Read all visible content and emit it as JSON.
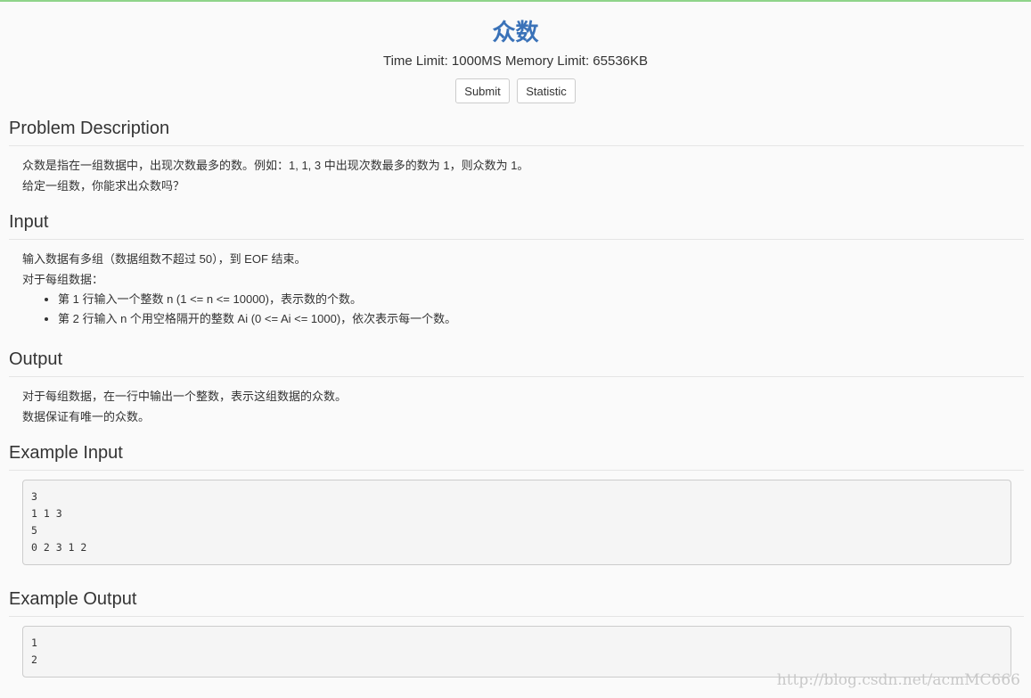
{
  "problem": {
    "title": "众数",
    "limits": "Time Limit: 1000MS Memory Limit: 65536KB"
  },
  "buttons": {
    "submit": "Submit",
    "statistic": "Statistic"
  },
  "sections": {
    "description": {
      "title": "Problem Description",
      "lines": [
        "众数是指在一组数据中，出现次数最多的数。例如：1, 1, 3 中出现次数最多的数为 1，则众数为 1。",
        "给定一组数，你能求出众数吗？"
      ]
    },
    "input": {
      "title": "Input",
      "lines": [
        "输入数据有多组（数据组数不超过 50），到 EOF 结束。",
        "对于每组数据："
      ],
      "bullets": [
        "第 1 行输入一个整数 n (1 <= n <= 10000)，表示数的个数。",
        "第 2 行输入 n 个用空格隔开的整数 Ai (0 <= Ai <= 1000)，依次表示每一个数。"
      ]
    },
    "output": {
      "title": "Output",
      "lines": [
        "对于每组数据，在一行中输出一个整数，表示这组数据的众数。",
        "数据保证有唯一的众数。"
      ]
    },
    "example_input": {
      "title": "Example Input",
      "content": "3\n1 1 3\n5\n0 2 3 1 2"
    },
    "example_output": {
      "title": "Example Output",
      "content": "1\n2"
    }
  },
  "watermark": "http://blog.csdn.net/acmMC666"
}
